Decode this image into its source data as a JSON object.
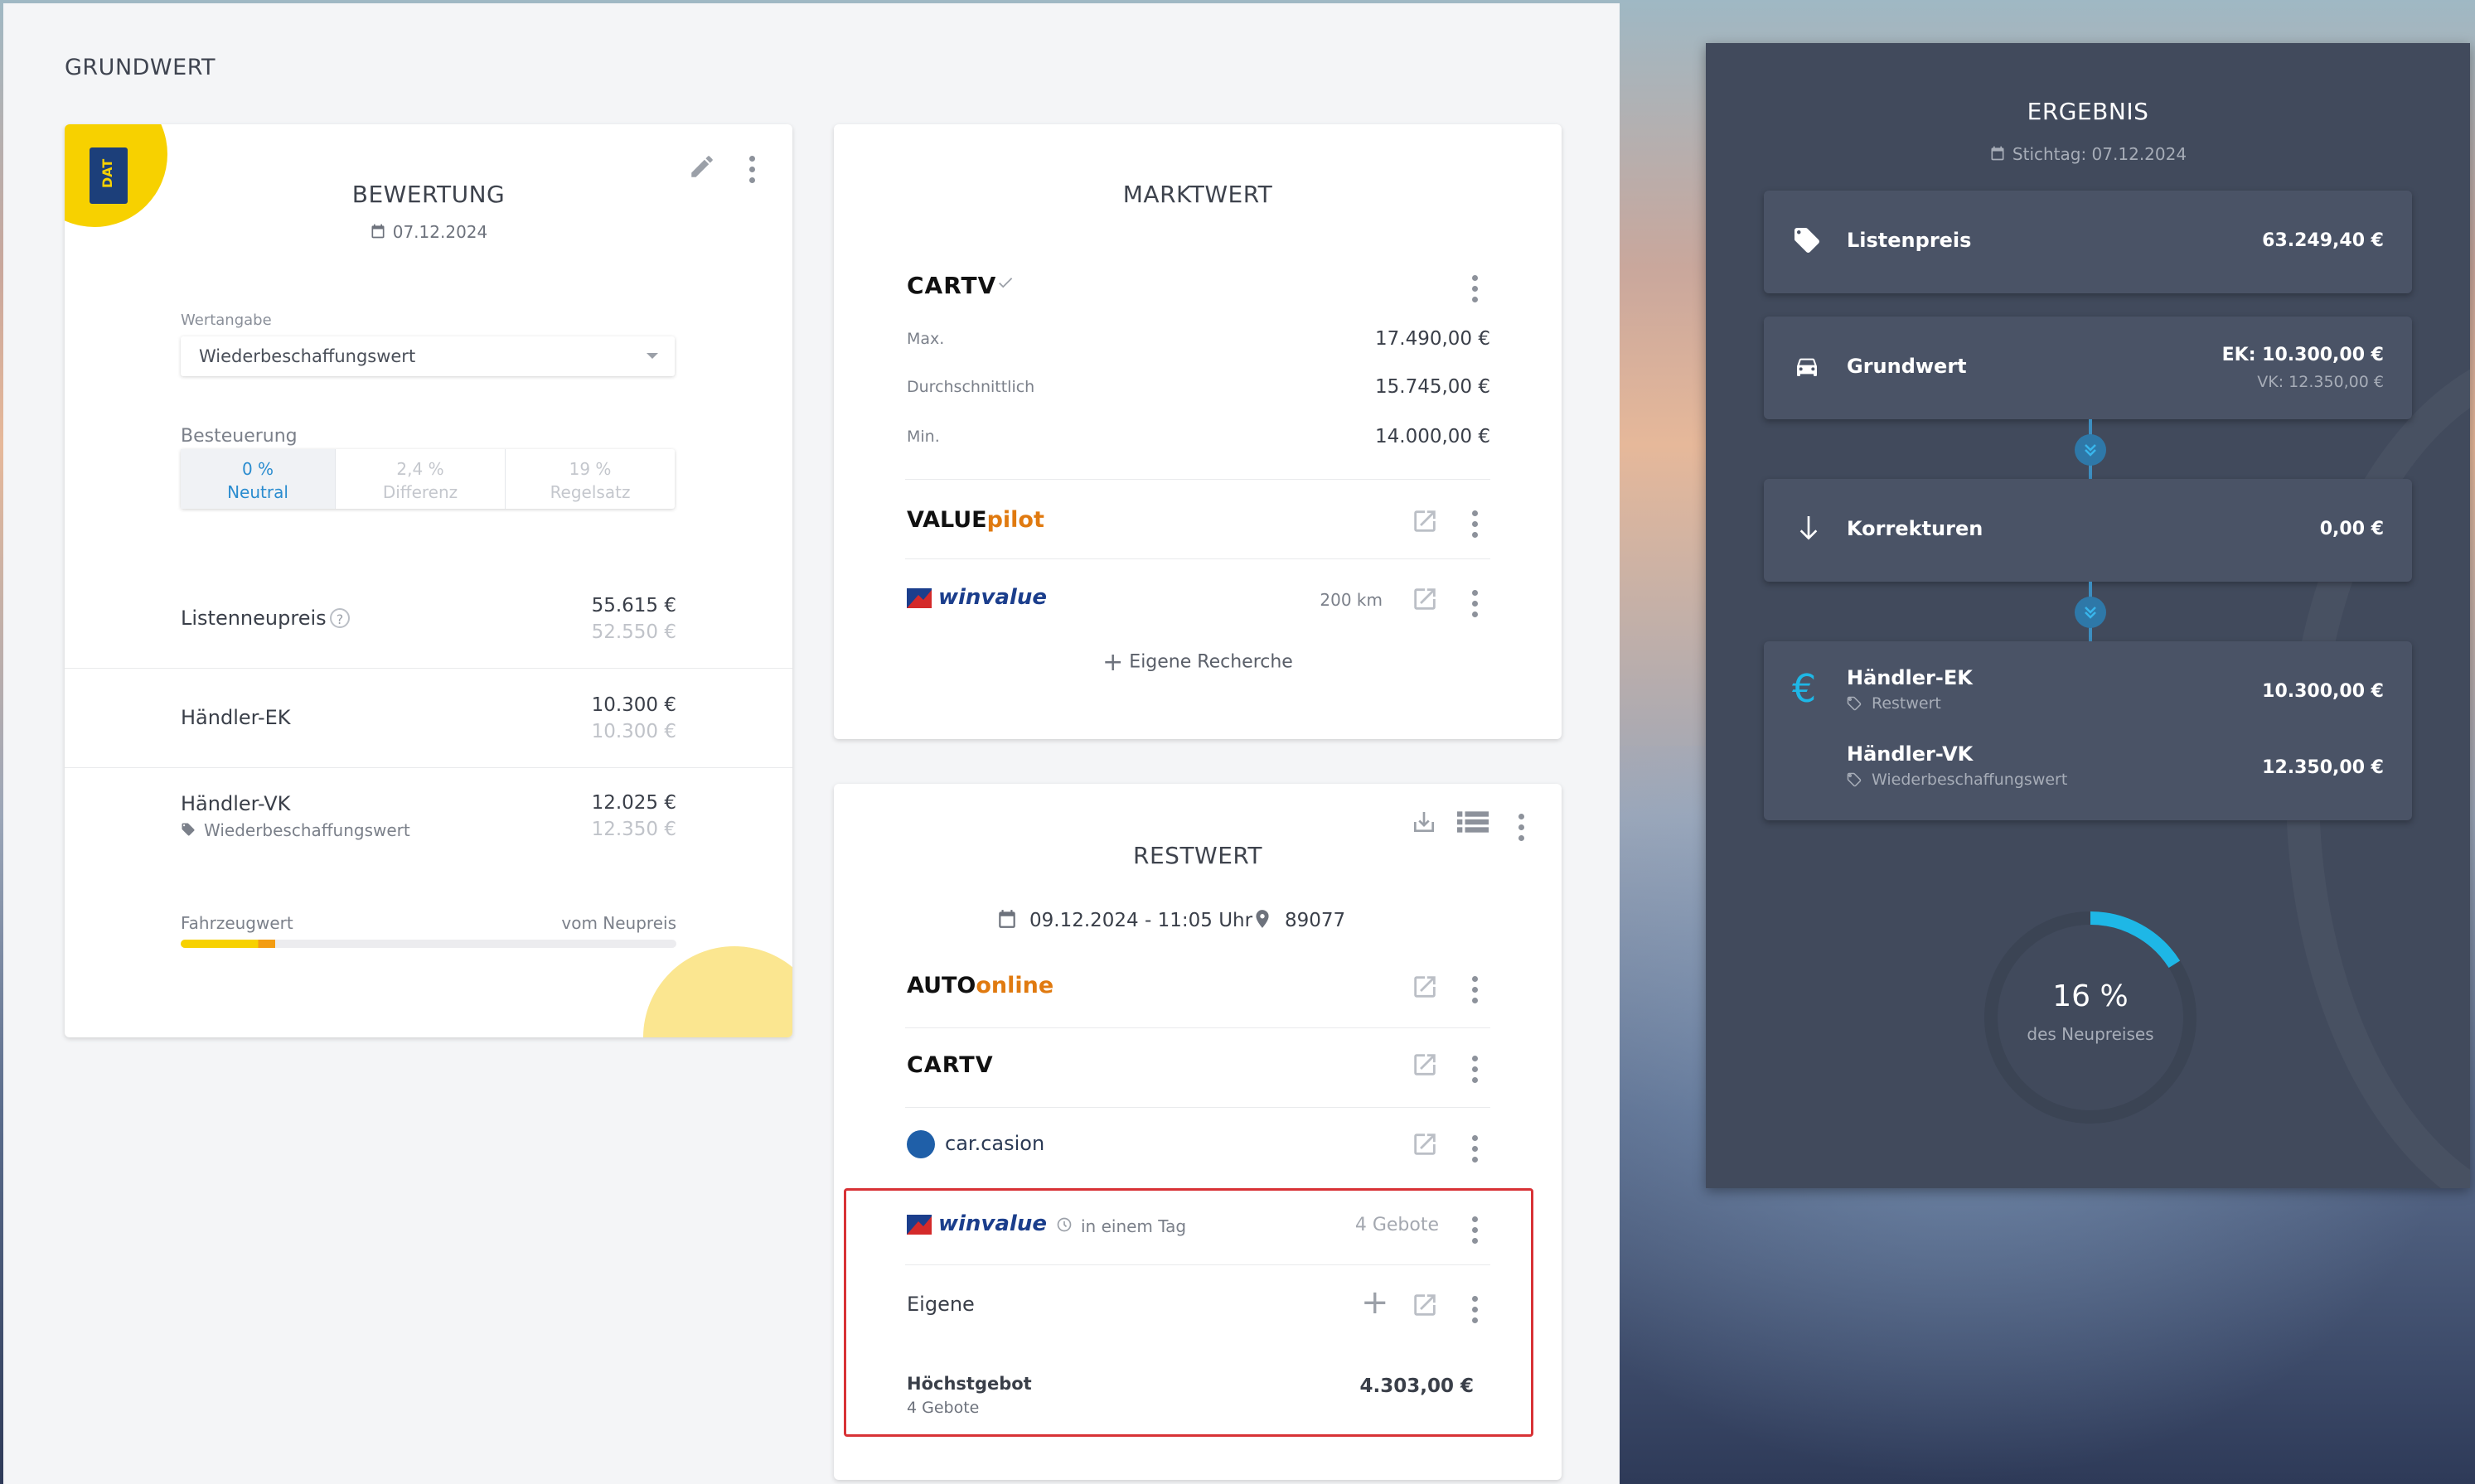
{
  "page": {
    "section_title": "GRUNDWERT"
  },
  "bewertung": {
    "title": "BEWERTUNG",
    "date": "07.12.2024",
    "wertangabe_label": "Wertangabe",
    "wertangabe_value": "Wiederbeschaffungswert",
    "besteuerung_label": "Besteuerung",
    "tax_options": [
      {
        "pct": "0 %",
        "name": "Neutral",
        "active": true
      },
      {
        "pct": "2,4 %",
        "name": "Differenz",
        "active": false
      },
      {
        "pct": "19 %",
        "name": "Regelsatz",
        "active": false
      }
    ],
    "rows": [
      {
        "label": "Listenneupreis",
        "value": "55.615 €",
        "secondary": "52.550 €"
      },
      {
        "label": "Händler-EK",
        "value": "10.300 €",
        "secondary": "10.300 €"
      },
      {
        "label": "Händler-VK",
        "sublabel": "Wiederbeschaffungswert",
        "value": "12.025 €",
        "secondary": "12.350 €"
      }
    ],
    "fahrzeugwert_label": "Fahrzeugwert",
    "vom_neupreis_label": "vom Neupreis",
    "progress_fraction": 0.19,
    "badge_text": "DAT"
  },
  "marktwert": {
    "title": "MARKTWERT",
    "cartv": {
      "logo": "CARTV",
      "rows": [
        {
          "label": "Max.",
          "value": "17.490,00 €"
        },
        {
          "label": "Durchschnittlich",
          "value": "15.745,00 €"
        },
        {
          "label": "Min.",
          "value": "14.000,00 €"
        }
      ]
    },
    "valuepilot": {
      "logo_a": "VALUE",
      "logo_b": "pilot"
    },
    "winvalue": {
      "logo": "winvalue",
      "distance": "200 km"
    },
    "eigene_recherche": "Eigene Recherche"
  },
  "restwert": {
    "title": "RESTWERT",
    "datetime": "09.12.2024 - 11:05 Uhr",
    "zip": "89077",
    "autoonline": {
      "logo_a": "AUTO",
      "logo_b": "online"
    },
    "cartv": {
      "logo": "CARTV"
    },
    "carcasion": {
      "logo": "car.casion"
    },
    "winvalue": {
      "logo": "winvalue",
      "time": "in einem Tag",
      "bids": "4 Gebote"
    },
    "eigene": "Eigene",
    "hoechstgebot_label": "Höchstgebot",
    "hoechstgebot_sub": "4 Gebote",
    "hoechstgebot_value": "4.303,00 €"
  },
  "ergebnis": {
    "title": "ERGEBNIS",
    "stichtag": "Stichtag: 07.12.2024",
    "listenpreis": {
      "label": "Listenpreis",
      "value": "63.249,40 €"
    },
    "grundwert": {
      "label": "Grundwert",
      "ek": "EK: 10.300,00 €",
      "vk": "VK: 12.350,00 €"
    },
    "korrekturen": {
      "label": "Korrekturen",
      "value": "0,00 €"
    },
    "haendler_ek": {
      "label": "Händler-EK",
      "sub": "Restwert",
      "value": "10.300,00 €"
    },
    "haendler_vk": {
      "label": "Händler-VK",
      "sub": "Wiederbeschaffungswert",
      "value": "12.350,00 €"
    },
    "gauge": {
      "pct_text": "16 %",
      "caption": "des Neupreises",
      "fraction": 0.16
    },
    "accent": "#1eb7e6"
  }
}
